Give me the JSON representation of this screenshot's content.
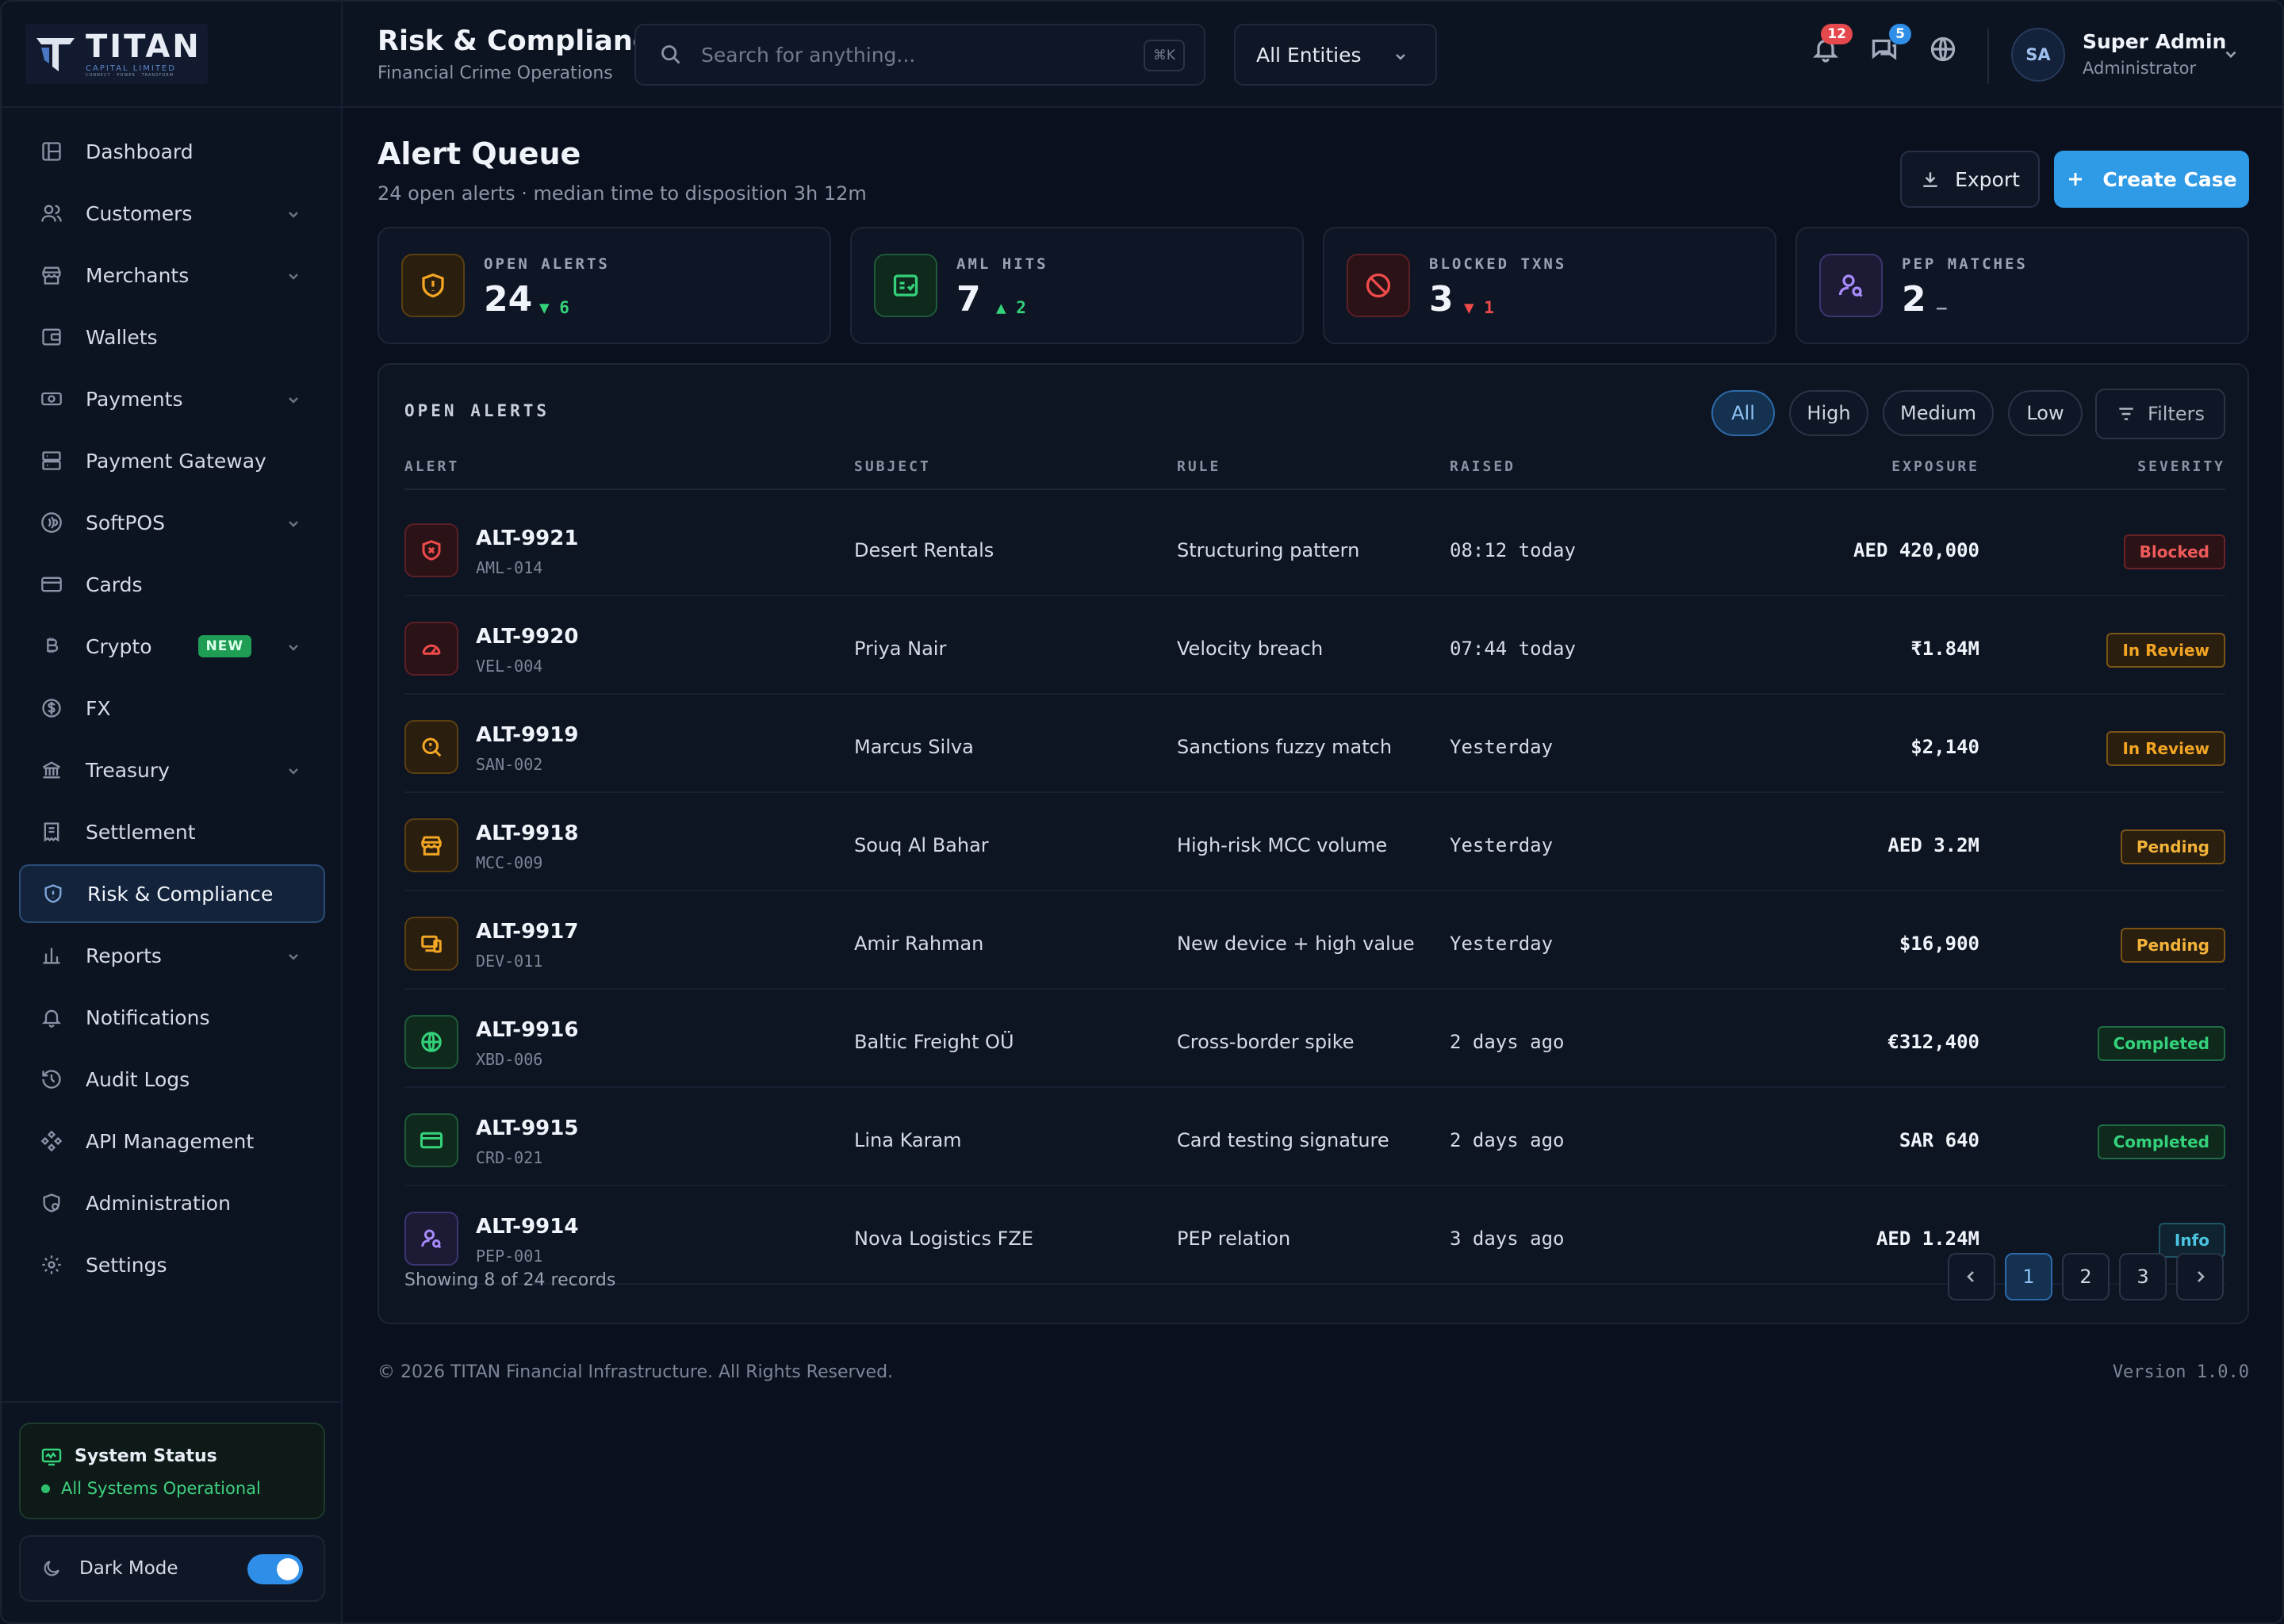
{
  "brand": {
    "name": "TITAN",
    "sub": "CAPITAL LIMITED",
    "tagline": "CONNECT · POWER · TRANSFORM"
  },
  "sidebar": {
    "items": [
      {
        "label": "Dashboard"
      },
      {
        "label": "Customers"
      },
      {
        "label": "Merchants"
      },
      {
        "label": "Wallets"
      },
      {
        "label": "Payments"
      },
      {
        "label": "Payment Gateway"
      },
      {
        "label": "SoftPOS"
      },
      {
        "label": "Cards"
      },
      {
        "label": "Crypto",
        "badge": "NEW"
      },
      {
        "label": "FX"
      },
      {
        "label": "Treasury"
      },
      {
        "label": "Settlement"
      },
      {
        "label": "Risk & Compliance"
      },
      {
        "label": "Reports"
      },
      {
        "label": "Notifications"
      },
      {
        "label": "Audit Logs"
      },
      {
        "label": "API Management"
      },
      {
        "label": "Administration"
      },
      {
        "label": "Settings"
      }
    ],
    "system_status": {
      "title": "System Status",
      "text": "All Systems Operational"
    },
    "dark_mode": {
      "label": "Dark Mode",
      "on": true
    }
  },
  "header": {
    "title": "Risk & Compliance",
    "subtitle": "Financial Crime Operations",
    "search_placeholder": "Search for anything...",
    "search_shortcut": "⌘K",
    "entity_select": "All Entities",
    "notifications_count": "12",
    "messages_count": "5",
    "user": {
      "initials": "SA",
      "name": "Super Admin",
      "role": "Administrator"
    }
  },
  "page": {
    "title": "Alert Queue",
    "subtitle": "24 open alerts · median time to disposition 3h 12m",
    "export_label": "Export",
    "create_label": "Create Case"
  },
  "stats": [
    {
      "label": "OPEN ALERTS",
      "value": "24",
      "delta": "▼ 6",
      "delta_color": "#34d27a"
    },
    {
      "label": "AML HITS",
      "value": "7",
      "delta": "▲ 2",
      "delta_color": "#34d27a"
    },
    {
      "label": "BLOCKED TXNS",
      "value": "3",
      "delta": "▼ 1",
      "delta_color": "#ef4b4b"
    },
    {
      "label": "PEP MATCHES",
      "value": "2",
      "delta": "—",
      "delta_color": "#9aa3b3"
    }
  ],
  "table": {
    "title": "OPEN ALERTS",
    "filters": [
      "All",
      "High",
      "Medium",
      "Low"
    ],
    "filters_label": "Filters",
    "columns": [
      "ALERT",
      "SUBJECT",
      "RULE",
      "RAISED",
      "EXPOSURE",
      "SEVERITY"
    ],
    "rows": [
      {
        "id": "ALT-9921",
        "code": "AML-014",
        "subject": "Desert Rentals",
        "rule": "Structuring pattern",
        "raised": "08:12 today",
        "exposure": "AED 420,000",
        "status": "Blocked",
        "icon": "shield-x-icon"
      },
      {
        "id": "ALT-9920",
        "code": "VEL-004",
        "subject": "Priya Nair",
        "rule": "Velocity breach",
        "raised": "07:44 today",
        "exposure": "₹1.84M",
        "status": "In Review",
        "icon": "gauge-icon"
      },
      {
        "id": "ALT-9919",
        "code": "SAN-002",
        "subject": "Marcus Silva",
        "rule": "Sanctions fuzzy match",
        "raised": "Yesterday",
        "exposure": "$2,140",
        "status": "In Review",
        "icon": "search-alert-icon"
      },
      {
        "id": "ALT-9918",
        "code": "MCC-009",
        "subject": "Souq Al Bahar",
        "rule": "High-risk MCC volume",
        "raised": "Yesterday",
        "exposure": "AED 3.2M",
        "status": "Pending",
        "icon": "store-icon"
      },
      {
        "id": "ALT-9917",
        "code": "DEV-011",
        "subject": "Amir Rahman",
        "rule": "New device + high value",
        "raised": "Yesterday",
        "exposure": "$16,900",
        "status": "Pending",
        "icon": "devices-icon"
      },
      {
        "id": "ALT-9916",
        "code": "XBD-006",
        "subject": "Baltic Freight OÜ",
        "rule": "Cross-border spike",
        "raised": "2 days ago",
        "exposure": "€312,400",
        "status": "Completed",
        "icon": "globe-icon"
      },
      {
        "id": "ALT-9915",
        "code": "CRD-021",
        "subject": "Lina Karam",
        "rule": "Card testing signature",
        "raised": "2 days ago",
        "exposure": "SAR 640",
        "status": "Completed",
        "icon": "card-icon"
      },
      {
        "id": "ALT-9914",
        "code": "PEP-001",
        "subject": "Nova Logistics FZE",
        "rule": "PEP relation",
        "raised": "3 days ago",
        "exposure": "AED 1.24M",
        "status": "Info",
        "icon": "user-search-icon"
      }
    ],
    "showing": "Showing 8 of 24 records",
    "pages": [
      "1",
      "2",
      "3"
    ]
  },
  "footer": {
    "copyright": "© 2026 TITAN Financial Infrastructure. All Rights Reserved.",
    "version": "Version 1.0.0"
  }
}
